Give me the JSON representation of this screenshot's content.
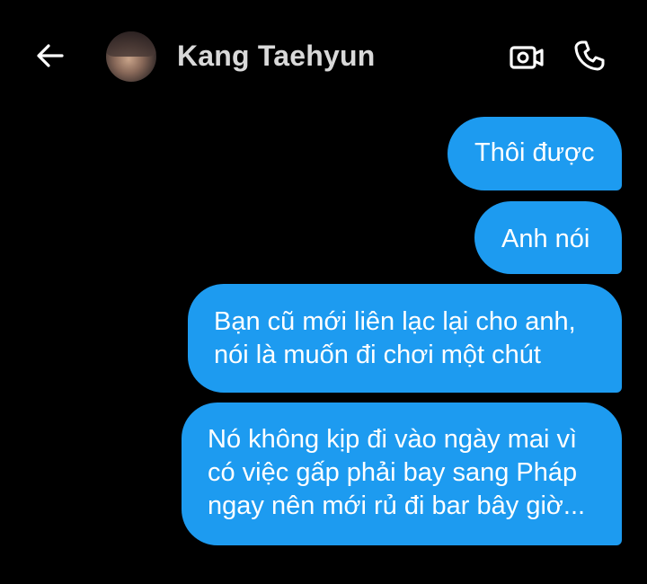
{
  "header": {
    "contact_name": "Kang Taehyun",
    "back_icon": "arrow-left-icon",
    "video_icon": "video-call-icon",
    "call_icon": "phone-icon"
  },
  "messages": [
    {
      "lines": [
        "Thôi được"
      ]
    },
    {
      "lines": [
        "Anh nói"
      ]
    },
    {
      "lines": [
        "Bạn cũ mới liên lạc lại cho anh,",
        "nói là muốn đi chơi một chút"
      ]
    },
    {
      "lines": [
        "Nó không kịp đi vào ngày mai vì",
        "có việc gấp phải bay sang Pháp",
        "ngay nên mới rủ đi bar bây giờ..."
      ]
    }
  ],
  "colors": {
    "background": "#000000",
    "bubble": "#1d9bf0",
    "bubble_text": "#ffffff",
    "header_text": "#d9d9d9"
  }
}
